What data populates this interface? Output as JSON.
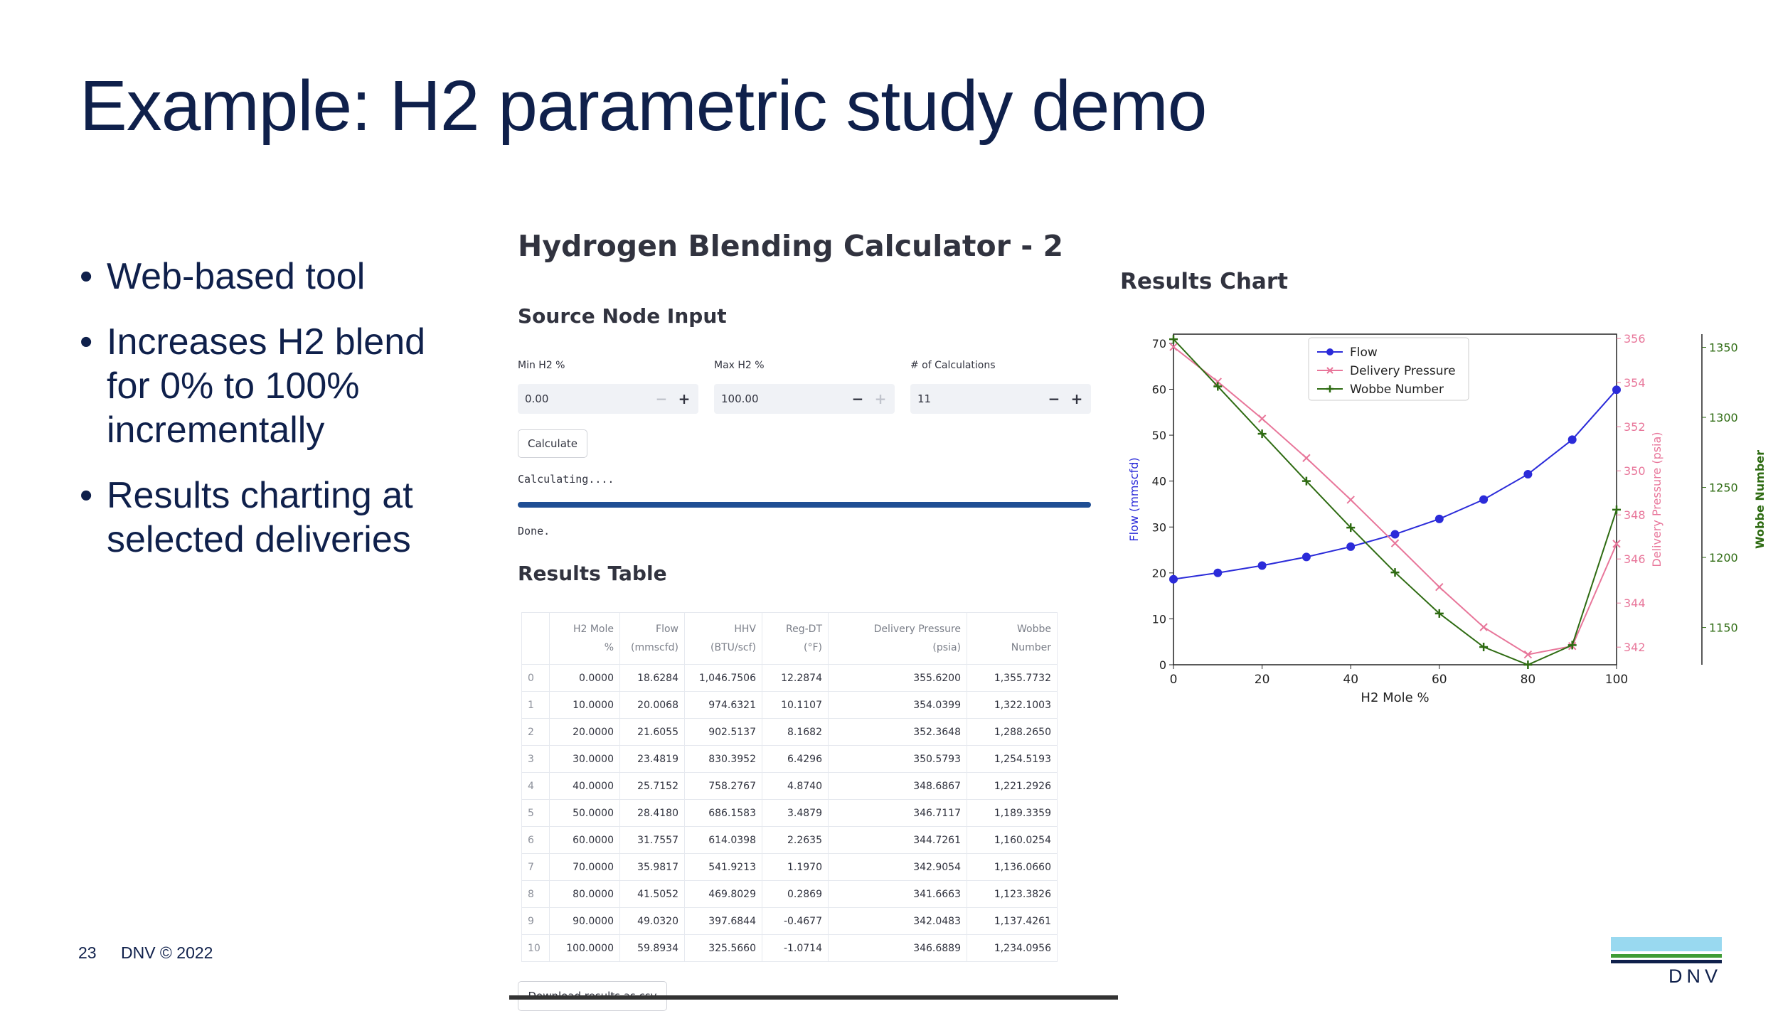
{
  "slide": {
    "title": "Example: H2 parametric study demo",
    "bullets": [
      "Web-based tool",
      "Increases H2 blend for 0% to 100% incrementally",
      "Results charting at selected deliveries"
    ],
    "page_number": "23",
    "copyright": "DNV © 2022",
    "logo_text": "DNV"
  },
  "app": {
    "title": "Hydrogen Blending Calculator - 2",
    "source_heading": "Source Node Input",
    "inputs": [
      {
        "label": "Min H2 %",
        "value": "0.00"
      },
      {
        "label": "Max H2 %",
        "value": "100.00"
      },
      {
        "label": "# of Calculations",
        "value": "11"
      }
    ],
    "calculate_label": "Calculate",
    "status_calculating": "Calculating....",
    "progress": 1.0,
    "status_done": "Done.",
    "results_table_heading": "Results Table",
    "download_label": "Download results as csv"
  },
  "table": {
    "headers": [
      [
        "",
        ""
      ],
      [
        "H2 Mole",
        "%"
      ],
      [
        "Flow",
        "(mmscfd)"
      ],
      [
        "HHV",
        "(BTU/scf)"
      ],
      [
        "Reg-DT",
        "(°F)"
      ],
      [
        "Delivery Pressure",
        "(psia)"
      ],
      [
        "Wobbe",
        "Number"
      ]
    ],
    "rows": [
      [
        "0",
        "0.0000",
        "18.6284",
        "1,046.7506",
        "12.2874",
        "355.6200",
        "1,355.7732"
      ],
      [
        "1",
        "10.0000",
        "20.0068",
        "974.6321",
        "10.1107",
        "354.0399",
        "1,322.1003"
      ],
      [
        "2",
        "20.0000",
        "21.6055",
        "902.5137",
        "8.1682",
        "352.3648",
        "1,288.2650"
      ],
      [
        "3",
        "30.0000",
        "23.4819",
        "830.3952",
        "6.4296",
        "350.5793",
        "1,254.5193"
      ],
      [
        "4",
        "40.0000",
        "25.7152",
        "758.2767",
        "4.8740",
        "348.6867",
        "1,221.2926"
      ],
      [
        "5",
        "50.0000",
        "28.4180",
        "686.1583",
        "3.4879",
        "346.7117",
        "1,189.3359"
      ],
      [
        "6",
        "60.0000",
        "31.7557",
        "614.0398",
        "2.2635",
        "344.7261",
        "1,160.0254"
      ],
      [
        "7",
        "70.0000",
        "35.9817",
        "541.9213",
        "1.1970",
        "342.9054",
        "1,136.0660"
      ],
      [
        "8",
        "80.0000",
        "41.5052",
        "469.8029",
        "0.2869",
        "341.6663",
        "1,123.3826"
      ],
      [
        "9",
        "90.0000",
        "49.0320",
        "397.6844",
        "-0.4677",
        "342.0483",
        "1,137.4261"
      ],
      [
        "10",
        "100.0000",
        "59.8934",
        "325.5660",
        "-1.0714",
        "346.6889",
        "1,234.0956"
      ]
    ]
  },
  "chart_data": {
    "type": "line",
    "title": "Results Chart",
    "xlabel": "H2 Mole %",
    "x": [
      0,
      10,
      20,
      30,
      40,
      50,
      60,
      70,
      80,
      90,
      100
    ],
    "xlim": [
      0,
      100
    ],
    "xticks": [
      0,
      20,
      40,
      60,
      80,
      100
    ],
    "legend_position": "top-center",
    "series": [
      {
        "name": "Flow",
        "axis": "left",
        "ylabel": "Flow (mmscfd)",
        "color": "#2b2bd9",
        "marker": "circle",
        "values": [
          18.6284,
          20.0068,
          21.6055,
          23.4819,
          25.7152,
          28.418,
          31.7557,
          35.9817,
          41.5052,
          49.032,
          59.8934
        ],
        "ylim": [
          0,
          72
        ],
        "yticks": [
          0,
          10,
          20,
          30,
          40,
          50,
          60,
          70
        ]
      },
      {
        "name": "Delivery Pressure",
        "axis": "right1",
        "ylabel": "Delivery Pressure (psia)",
        "color": "#e8769a",
        "marker": "x",
        "values": [
          355.62,
          354.0399,
          352.3648,
          350.5793,
          348.6867,
          346.7117,
          344.7261,
          342.9054,
          341.6663,
          342.0483,
          346.6889
        ],
        "ylim": [
          341.2,
          356.2
        ],
        "yticks": [
          342,
          344,
          346,
          348,
          350,
          352,
          354,
          356
        ]
      },
      {
        "name": "Wobbe Number",
        "axis": "right2",
        "ylabel": "Wobbe Number",
        "color": "#2e6b12",
        "marker": "plus",
        "values": [
          1355.7732,
          1322.1003,
          1288.265,
          1254.5193,
          1221.2926,
          1189.3359,
          1160.0254,
          1136.066,
          1123.3826,
          1137.4261,
          1234.0956
        ],
        "ylim": [
          1123.4,
          1359.4
        ],
        "yticks": [
          1150,
          1200,
          1250,
          1300,
          1350
        ]
      }
    ]
  }
}
